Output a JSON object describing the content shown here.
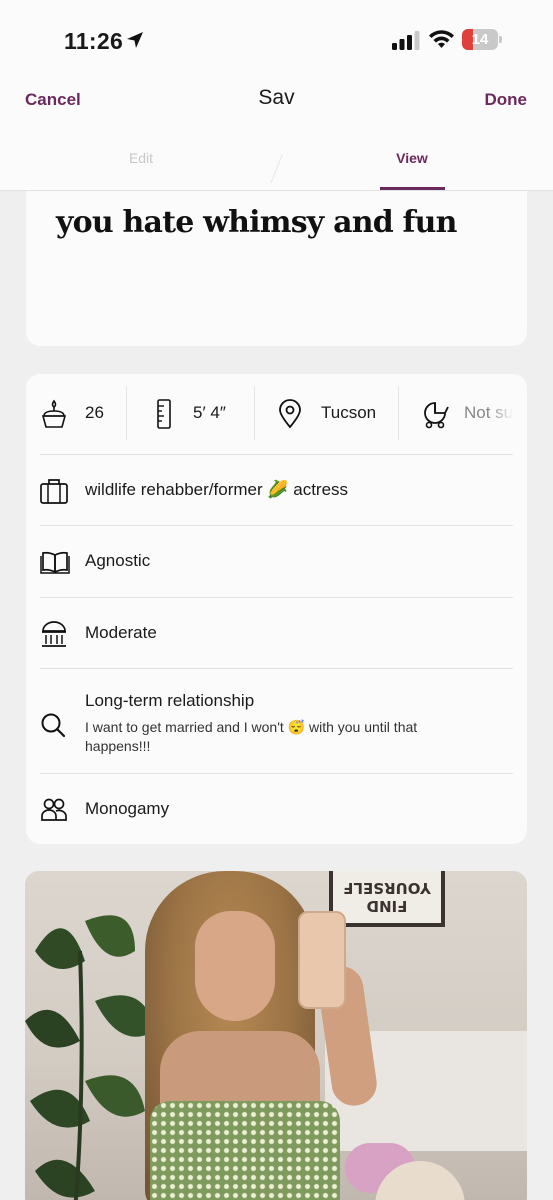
{
  "status_bar": {
    "time": "11:26",
    "battery_percent": "14",
    "battery_level": 0.14,
    "icons": [
      "location-arrow-icon",
      "cellular-signal-icon",
      "wifi-icon",
      "battery-icon"
    ]
  },
  "nav": {
    "cancel_label": "Cancel",
    "title": "Sav",
    "done_label": "Done"
  },
  "tabs": {
    "edit_label": "Edit",
    "view_label": "View",
    "active": "View"
  },
  "prompt_card": {
    "answer": "you hate whimsy and fun"
  },
  "vitals": {
    "age": "26",
    "height": "5′ 4″",
    "location": "Tucson",
    "children": "Not su"
  },
  "details": {
    "job": "wildlife rehabber/former 🌽 actress",
    "religion": "Agnostic",
    "politics": "Moderate",
    "dating_intention": "Long-term relationship",
    "dating_intention_note": "I want to get married and I won't 😴 with you until that happens!!!",
    "relationship_type": "Monogamy"
  },
  "photo": {
    "poster_text": "FIND YOURSELF"
  },
  "colors": {
    "accent": "#6b2a5e",
    "background": "#efefef",
    "card": "#fbfbfb"
  }
}
